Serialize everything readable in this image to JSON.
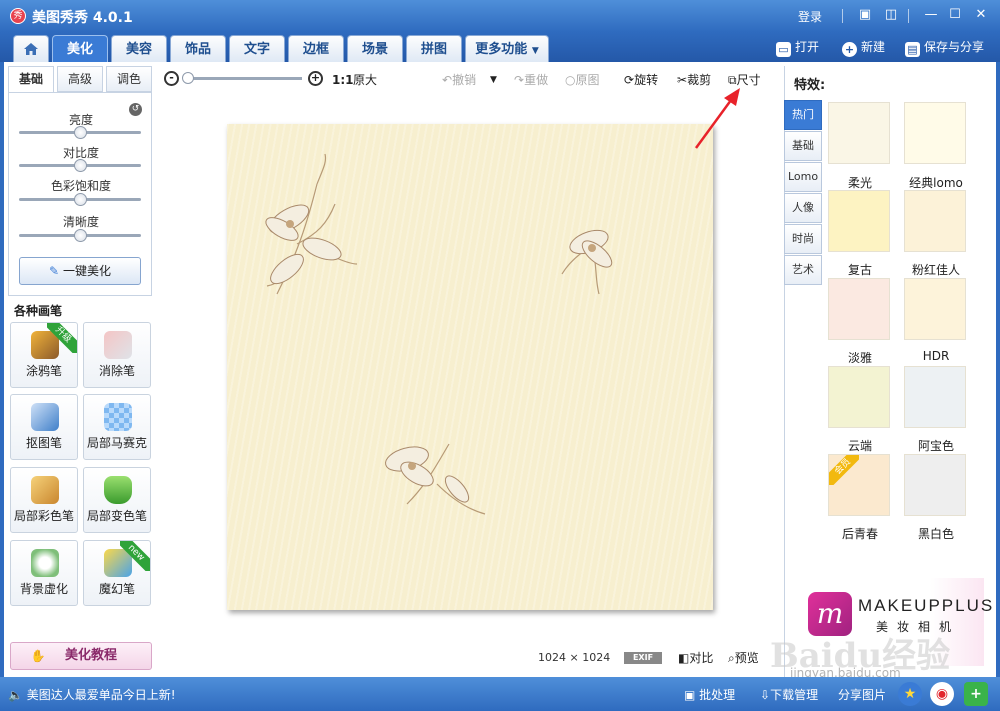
{
  "app": {
    "title": "美图秀秀 4.0.1",
    "logo_text": "秀",
    "login": "登录"
  },
  "window_controls": [
    "message-icon",
    "skin-icon",
    "minimize-icon",
    "maximize-icon",
    "close-icon"
  ],
  "nav": {
    "home_icon": "home-icon",
    "tabs": [
      "美化",
      "美容",
      "饰品",
      "文字",
      "边框",
      "场景",
      "拼图",
      "更多功能"
    ],
    "active_tab": "美化",
    "actions": {
      "open": "打开",
      "new": "新建",
      "save": "保存与分享"
    }
  },
  "left": {
    "subtabs": [
      "基础",
      "高级",
      "调色"
    ],
    "active_subtab": "基础",
    "sliders": [
      {
        "label": "亮度",
        "value": 0.5
      },
      {
        "label": "对比度",
        "value": 0.5
      },
      {
        "label": "色彩饱和度",
        "value": 0.5
      },
      {
        "label": "清晰度",
        "value": 0.5
      }
    ],
    "one_key": "一键美化",
    "brushes_title": "各种画笔",
    "tools": [
      {
        "label": "涂鸦笔",
        "badge": "升级"
      },
      {
        "label": "消除笔",
        "badge": ""
      },
      {
        "label": "抠图笔",
        "badge": ""
      },
      {
        "label": "局部马赛克",
        "badge": ""
      },
      {
        "label": "局部彩色笔",
        "badge": ""
      },
      {
        "label": "局部变色笔",
        "badge": ""
      },
      {
        "label": "背景虚化",
        "badge": ""
      },
      {
        "label": "魔幻笔",
        "badge": "new"
      }
    ],
    "tutorial": "美化教程"
  },
  "toolbar": {
    "ratio": "1:1",
    "original_size": "原大",
    "zoom_value": 0.0,
    "undo": "撤销",
    "redo": "重做",
    "original": "原图",
    "rotate": "旋转",
    "crop": "裁剪",
    "size": "尺寸"
  },
  "canvas": {
    "dimensions": "1024 × 1024",
    "exif": "EXIF",
    "compare": "对比",
    "preview": "预览",
    "photo_color": "#f7efcf"
  },
  "right": {
    "title": "特效:",
    "tabs": [
      "热门",
      "基础",
      "Lomo",
      "人像",
      "时尚",
      "艺术"
    ],
    "active_tab": "热门",
    "effects": [
      {
        "label": "柔光",
        "color": "#faf6e6"
      },
      {
        "label": "经典lomo",
        "color": "#fffbe8"
      },
      {
        "label": "复古",
        "color": "#fdf3c2"
      },
      {
        "label": "粉红佳人",
        "color": "#fcf2d8"
      },
      {
        "label": "淡雅",
        "color": "#fbe9e1"
      },
      {
        "label": "HDR",
        "color": "#fdf3da"
      },
      {
        "label": "云端",
        "color": "#f3f3d2"
      },
      {
        "label": "阿宝色",
        "color": "#edf1f3"
      },
      {
        "label": "后青春",
        "color": "#fbe9cf",
        "badge": "会员"
      },
      {
        "label": "黑白色",
        "color": "#eeeeee"
      }
    ],
    "ad": {
      "brand": "MAKEUPPLUS",
      "subtitle": "美妆相机",
      "logo_letter": "m"
    }
  },
  "bottom": {
    "news": "美图达人最爱单品今日上新!",
    "batch": "批处理",
    "download": "下载管理",
    "share": "分享图片"
  },
  "watermark": {
    "text": "Baidu经验",
    "url": "jingyan.baidu.com"
  }
}
